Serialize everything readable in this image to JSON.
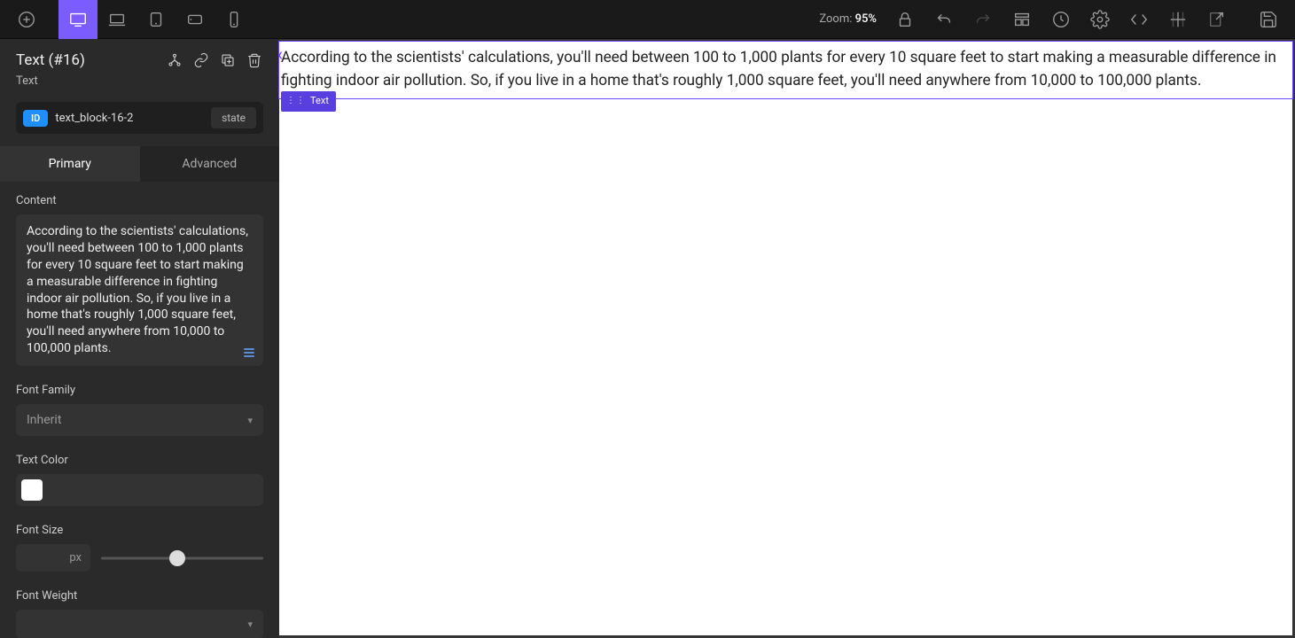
{
  "toolbar": {
    "zoom_label": "Zoom:",
    "zoom_value": "95%"
  },
  "element": {
    "title": "Text (#16)",
    "subtitle": "Text",
    "id_chip": "ID",
    "id_value": "text_block-16-2",
    "state_label": "state"
  },
  "tabs": {
    "primary": "Primary",
    "advanced": "Advanced"
  },
  "panels": {
    "content_label": "Content",
    "content_value": "According to the scientists' calculations, you'll need between 100 to 1,000 plants for every 10 square feet to start making a measurable difference in fighting indoor air pollution. So, if you live in a home that's roughly 1,000 square feet, you'll need anywhere from 10,000 to 100,000 plants.",
    "font_family_label": "Font Family",
    "font_family_value": "Inherit",
    "text_color_label": "Text Color",
    "text_color_value": "#ffffff",
    "font_size_label": "Font Size",
    "font_size_unit": "px",
    "font_weight_label": "Font Weight"
  },
  "canvas": {
    "text_tag": "Text",
    "paragraph": "According to the scientists' calculations, you'll need between 100 to 1,000 plants for every 10 square feet to start making a measurable difference in fighting indoor air pollution. So, if you live in a home that's roughly 1,000 square feet, you'll need anywhere from 10,000 to 100,000 plants."
  }
}
